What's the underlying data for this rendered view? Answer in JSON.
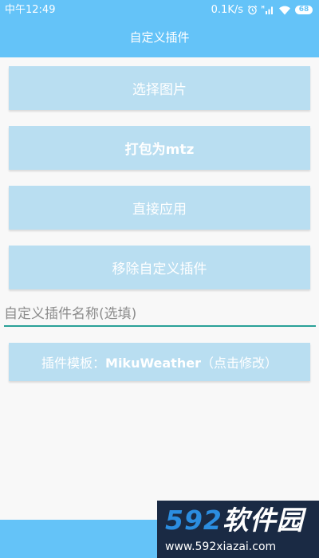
{
  "status_bar": {
    "time": "中午12:49",
    "network_speed": "0.1K/s",
    "battery": "68"
  },
  "app_bar": {
    "title": "自定义插件"
  },
  "actions": {
    "select_image": "选择图片",
    "pack_mtz": "打包为mtz",
    "apply_direct": "直接应用",
    "remove_custom": "移除自定义插件"
  },
  "plugin_name_input": {
    "placeholder": "自定义插件名称(选填)",
    "value": ""
  },
  "template_button": {
    "prefix": "插件模板：",
    "value": "MikuWeather",
    "suffix": "（点击修改）"
  },
  "watermark": {
    "digits": "592",
    "name": "软件园",
    "url": "www.592xiazai.com"
  },
  "colors": {
    "primary": "#64c3f8",
    "button_bg": "#b9def1",
    "input_underline": "#2aa198",
    "watermark_bg": "#1a2a44",
    "watermark_digits": "#2b8de0"
  }
}
